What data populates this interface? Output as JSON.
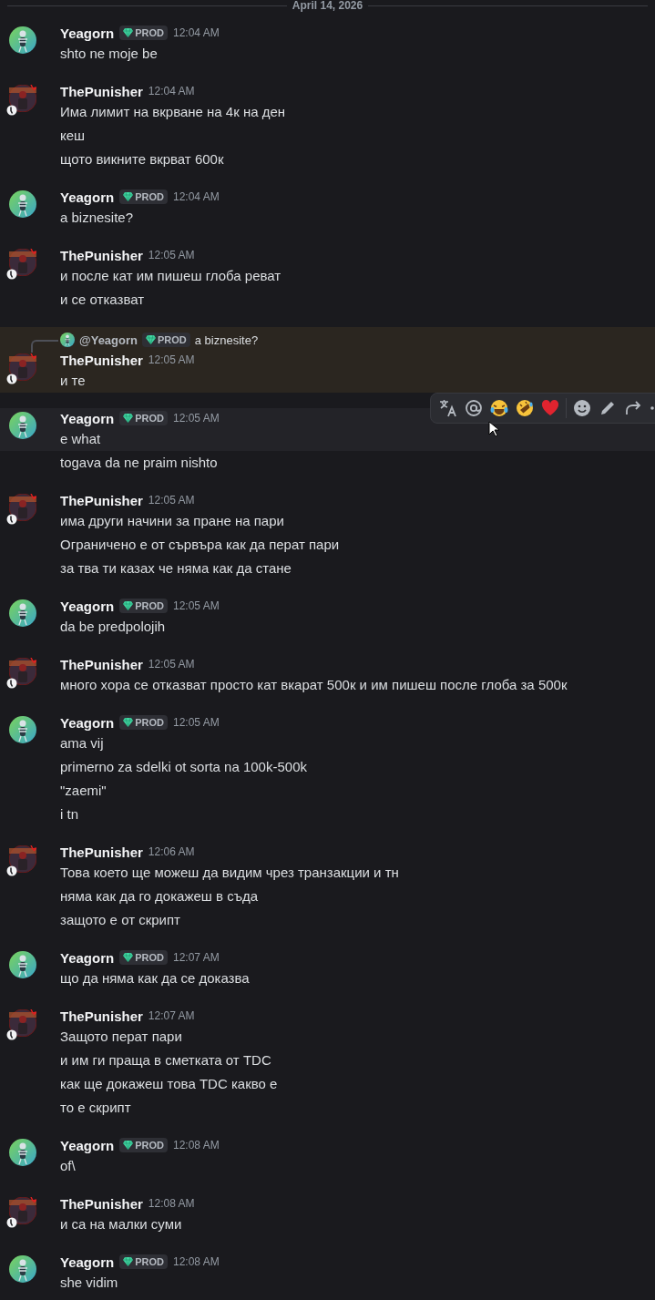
{
  "date_divider": "April 14, 2026",
  "messages": [
    {
      "author": "Yeagorn",
      "kind": "skeleton",
      "badge": "PROD",
      "time": "12:04 AM",
      "lines": [
        {
          "text": "shto ne moje be",
          "hovered": false
        }
      ]
    },
    {
      "author": "ThePunisher",
      "kind": "hooded",
      "time": "12:04 AM",
      "lines": [
        {
          "text": "Има лимит на вкрване на 4к на ден",
          "hovered": false
        },
        {
          "text": "кеш",
          "hovered": false
        },
        {
          "text": "щото викните вкрват 600к",
          "hovered": false
        }
      ]
    },
    {
      "author": "Yeagorn",
      "kind": "skeleton",
      "badge": "PROD",
      "time": "12:04 AM",
      "lines": [
        {
          "text": "a biznesite?",
          "hovered": false
        }
      ]
    },
    {
      "author": "ThePunisher",
      "kind": "hooded",
      "time": "12:05 AM",
      "lines": [
        {
          "text": "и после кат им пишеш глоба реват",
          "hovered": false
        },
        {
          "text": "и се отказват",
          "hovered": false
        }
      ]
    },
    {
      "author": "ThePunisher",
      "kind": "hooded",
      "time": "12:05 AM",
      "highlighted": true,
      "reply": {
        "author": "@Yeagorn",
        "kind": "skeleton",
        "badge": "PROD",
        "text": "a biznesite?"
      },
      "lines": [
        {
          "text": "и те",
          "hovered": false
        }
      ]
    },
    {
      "author": "Yeagorn",
      "kind": "skeleton",
      "badge": "PROD",
      "time": "12:05 AM",
      "lines": [
        {
          "text": "e what",
          "hovered": true
        },
        {
          "text": "togava da ne praim nishto",
          "hovered": false
        }
      ]
    },
    {
      "author": "ThePunisher",
      "kind": "hooded",
      "time": "12:05 AM",
      "lines": [
        {
          "text": "има други начини за пране на пари",
          "hovered": false
        },
        {
          "text": "Ограничено е от сървъра как да перат пари",
          "hovered": false
        },
        {
          "text": "за тва ти казах че няма как да стане",
          "hovered": false
        }
      ]
    },
    {
      "author": "Yeagorn",
      "kind": "skeleton",
      "badge": "PROD",
      "time": "12:05 AM",
      "lines": [
        {
          "text": "da be predpolojih",
          "hovered": false
        }
      ]
    },
    {
      "author": "ThePunisher",
      "kind": "hooded",
      "time": "12:05 AM",
      "lines": [
        {
          "text": "много хора се отказват просто кат вкарат 500к и им пишеш после глоба за 500к",
          "hovered": false
        }
      ]
    },
    {
      "author": "Yeagorn",
      "kind": "skeleton",
      "badge": "PROD",
      "time": "12:05 AM",
      "lines": [
        {
          "text": "ama vij",
          "hovered": false
        },
        {
          "text": "primerno za sdelki ot sorta na 100k-500k",
          "hovered": false
        },
        {
          "text": "\"zaemi\"",
          "hovered": false
        },
        {
          "text": "i tn",
          "hovered": false
        }
      ]
    },
    {
      "author": "ThePunisher",
      "kind": "hooded",
      "time": "12:06 AM",
      "lines": [
        {
          "text": "Това което ще можеш да видим чрез транзакции и тн",
          "hovered": false
        },
        {
          "text": "няма как да го докажеш в съда",
          "hovered": false
        },
        {
          "text": "защото е от скрипт",
          "hovered": false
        }
      ]
    },
    {
      "author": "Yeagorn",
      "kind": "skeleton",
      "badge": "PROD",
      "time": "12:07 AM",
      "lines": [
        {
          "text": "що да няма как да се доказва",
          "hovered": false
        }
      ]
    },
    {
      "author": "ThePunisher",
      "kind": "hooded",
      "time": "12:07 AM",
      "lines": [
        {
          "text": "Защото перат пари",
          "hovered": false
        },
        {
          "text": "и им ги праща в сметката от TDC",
          "hovered": false
        },
        {
          "text": "как ще докажеш това TDC какво е",
          "hovered": false
        },
        {
          "text": "то е скрипт",
          "hovered": false
        }
      ]
    },
    {
      "author": "Yeagorn",
      "kind": "skeleton",
      "badge": "PROD",
      "time": "12:08 AM",
      "lines": [
        {
          "text": "of\\",
          "hovered": false
        }
      ]
    },
    {
      "author": "ThePunisher",
      "kind": "hooded",
      "time": "12:08 AM",
      "lines": [
        {
          "text": "и са на малки суми",
          "hovered": false
        }
      ]
    },
    {
      "author": "Yeagorn",
      "kind": "skeleton",
      "badge": "PROD",
      "time": "12:08 AM",
      "lines": [
        {
          "text": "she vidim",
          "hovered": false
        }
      ]
    }
  ],
  "hover_toolbar": {
    "items": [
      {
        "kind": "translate"
      },
      {
        "kind": "mention"
      },
      {
        "kind": "joy"
      },
      {
        "kind": "rofl"
      },
      {
        "kind": "heart"
      },
      {
        "kind": "divider"
      },
      {
        "kind": "add_reaction"
      },
      {
        "kind": "edit"
      },
      {
        "kind": "forward"
      },
      {
        "kind": "more"
      }
    ]
  }
}
